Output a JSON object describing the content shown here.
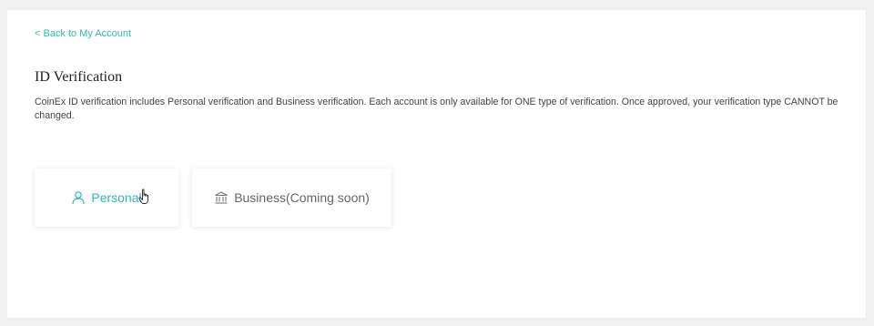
{
  "back_link": {
    "label": "< Back to My Account"
  },
  "page": {
    "title": "ID Verification",
    "description": "CoinEx ID verification includes Personal verification and Business verification. Each account is only available for ONE type of verification. Once approved, your verification type CANNOT be changed."
  },
  "options": [
    {
      "label": "Personal",
      "icon": "user-icon",
      "color": "#2fb9b3",
      "state": "hovered"
    },
    {
      "label": "Business(Coming soon)",
      "icon": "bank-icon",
      "color": "#666666",
      "state": "disabled"
    }
  ],
  "colors": {
    "accent": "#2fb9b3",
    "page_background": "#f0f0f0",
    "panel_background": "#ffffff"
  }
}
